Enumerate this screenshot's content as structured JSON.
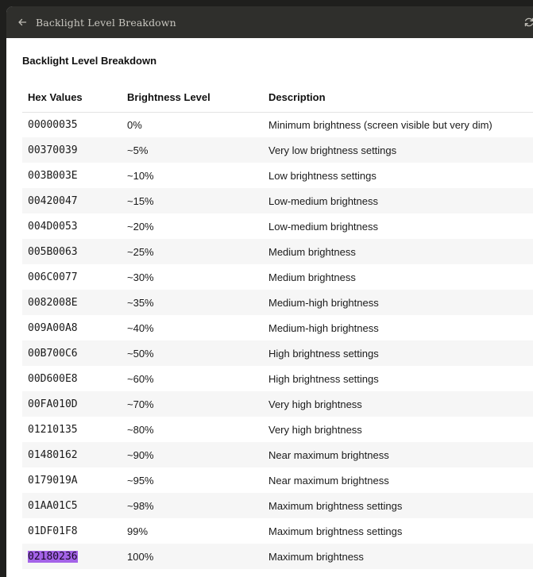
{
  "window": {
    "title": "Backlight Level Breakdown"
  },
  "icons": {
    "back": "arrow-left-icon",
    "refresh": "refresh-icon"
  },
  "document": {
    "title": "Backlight Level Breakdown"
  },
  "table": {
    "headers": [
      "Hex Values",
      "Brightness Level",
      "Description"
    ],
    "rows": [
      {
        "hex": "00000035",
        "level": "0%",
        "desc": "Minimum brightness (screen visible but very dim)"
      },
      {
        "hex": "00370039",
        "level": "~5%",
        "desc": "Very low brightness settings"
      },
      {
        "hex": "003B003E",
        "level": "~10%",
        "desc": "Low brightness settings"
      },
      {
        "hex": "00420047",
        "level": "~15%",
        "desc": "Low-medium brightness"
      },
      {
        "hex": "004D0053",
        "level": "~20%",
        "desc": "Low-medium brightness"
      },
      {
        "hex": "005B0063",
        "level": "~25%",
        "desc": "Medium brightness"
      },
      {
        "hex": "006C0077",
        "level": "~30%",
        "desc": "Medium brightness"
      },
      {
        "hex": "0082008E",
        "level": "~35%",
        "desc": "Medium-high brightness"
      },
      {
        "hex": "009A00A8",
        "level": "~40%",
        "desc": "Medium-high brightness"
      },
      {
        "hex": "00B700C6",
        "level": "~50%",
        "desc": "High brightness settings"
      },
      {
        "hex": "00D600E8",
        "level": "~60%",
        "desc": "High brightness settings"
      },
      {
        "hex": "00FA010D",
        "level": "~70%",
        "desc": "Very high brightness"
      },
      {
        "hex": "01210135",
        "level": "~80%",
        "desc": "Very high brightness"
      },
      {
        "hex": "01480162",
        "level": "~90%",
        "desc": "Near maximum brightness"
      },
      {
        "hex": "0179019A",
        "level": "~95%",
        "desc": "Near maximum brightness"
      },
      {
        "hex": "01AA01C5",
        "level": "~98%",
        "desc": "Maximum brightness settings"
      },
      {
        "hex": "01DF01F8",
        "level": "99%",
        "desc": "Maximum brightness settings"
      },
      {
        "hex": "02180236",
        "level": "100%",
        "desc": "Maximum brightness",
        "selected": true
      }
    ]
  },
  "colors": {
    "titlebar": "#2f2f2c",
    "selection": "#a463e8",
    "stripe": "#f6f6f6"
  }
}
